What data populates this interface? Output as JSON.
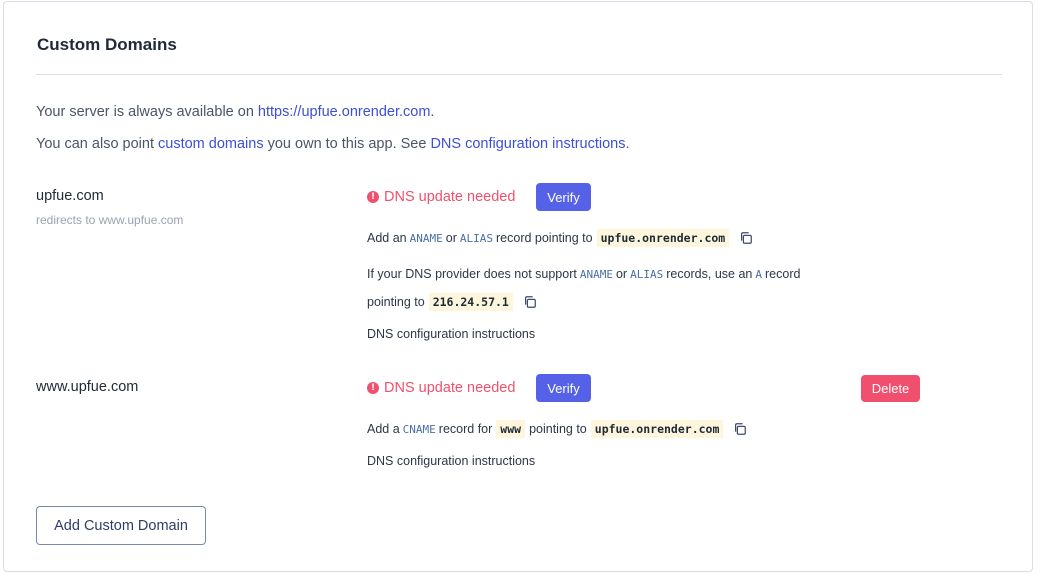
{
  "section_title": "Custom Domains",
  "intro": {
    "line1_prefix": "Your server is always available on ",
    "server_url": "https://upfue.onrender.com",
    "line1_suffix": ".",
    "line2_prefix": "You can also point ",
    "custom_domains_link": "custom domains",
    "line2_middle": " you own to this app. See ",
    "dns_instructions_link": "DNS configuration instructions",
    "line2_suffix": "."
  },
  "domains": [
    {
      "name": "upfue.com",
      "redirect_note": "redirects to www.upfue.com",
      "status": "DNS update needed",
      "verify_label": "Verify",
      "instr1": {
        "p1": "Add an ",
        "k1": "ANAME",
        "p2": " or ",
        "k2": "ALIAS",
        "p3": " record pointing to",
        "target": "upfue.onrender.com"
      },
      "instr2": {
        "p1": "If your DNS provider does not support ",
        "k1": "ANAME",
        "p2": " or ",
        "k2": "ALIAS",
        "p3": " records, use an ",
        "k3": "A",
        "p4": " record"
      },
      "instr3": {
        "p1": "pointing to",
        "ip": "216.24.57.1"
      },
      "dns_link": "DNS configuration instructions"
    },
    {
      "name": "www.upfue.com",
      "status": "DNS update needed",
      "verify_label": "Verify",
      "delete_label": "Delete",
      "instr1": {
        "p1": "Add a ",
        "k1": "CNAME",
        "p2": " record for",
        "host": "www",
        "p3": "pointing to",
        "target": "upfue.onrender.com"
      },
      "dns_link": "DNS configuration instructions"
    }
  ],
  "add_button_label": "Add Custom Domain",
  "colors": {
    "accent": "#5562e8",
    "danger": "#f0506e",
    "link": "#3b4fd8"
  }
}
